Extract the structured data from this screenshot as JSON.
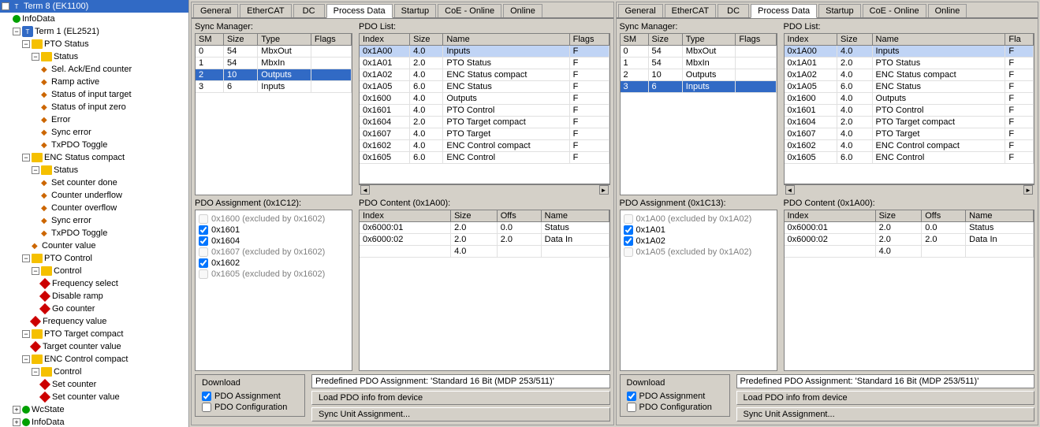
{
  "tree": {
    "items": [
      {
        "id": "term8",
        "label": "Term 8 (EK1100)",
        "level": 0,
        "type": "blue",
        "expanded": true
      },
      {
        "id": "infodata0",
        "label": "InfoData",
        "level": 1,
        "type": "folder"
      },
      {
        "id": "term1",
        "label": "Term 1 (EL2521)",
        "level": 1,
        "type": "blue",
        "expanded": true
      },
      {
        "id": "pto-status",
        "label": "PTO Status",
        "level": 2,
        "type": "folder",
        "expanded": true
      },
      {
        "id": "status1",
        "label": "Status",
        "level": 3,
        "type": "folder",
        "expanded": true
      },
      {
        "id": "sel-ack",
        "label": "Sel. Ack/End counter",
        "level": 4,
        "type": "arrow"
      },
      {
        "id": "ramp-active",
        "label": "Ramp active",
        "level": 4,
        "type": "arrow"
      },
      {
        "id": "status-input-target",
        "label": "Status of input target",
        "level": 4,
        "type": "arrow"
      },
      {
        "id": "status-input-zero",
        "label": "Status of input zero",
        "level": 4,
        "type": "arrow"
      },
      {
        "id": "error",
        "label": "Error",
        "level": 4,
        "type": "arrow"
      },
      {
        "id": "sync-error1",
        "label": "Sync error",
        "level": 4,
        "type": "arrow"
      },
      {
        "id": "txpdo-toggle1",
        "label": "TxPDO Toggle",
        "level": 4,
        "type": "arrow"
      },
      {
        "id": "enc-status",
        "label": "ENC Status compact",
        "level": 2,
        "type": "folder",
        "expanded": true
      },
      {
        "id": "status2",
        "label": "Status",
        "level": 3,
        "type": "folder",
        "expanded": true
      },
      {
        "id": "set-counter-done",
        "label": "Set counter done",
        "level": 4,
        "type": "arrow"
      },
      {
        "id": "counter-underflow",
        "label": "Counter underflow",
        "level": 4,
        "type": "arrow"
      },
      {
        "id": "counter-overflow",
        "label": "Counter overflow",
        "level": 4,
        "type": "arrow"
      },
      {
        "id": "sync-error2",
        "label": "Sync error",
        "level": 4,
        "type": "arrow"
      },
      {
        "id": "txpdo-toggle2",
        "label": "TxPDO Toggle",
        "level": 4,
        "type": "arrow"
      },
      {
        "id": "counter-value",
        "label": "Counter value",
        "level": 3,
        "type": "arrow"
      },
      {
        "id": "pto-control",
        "label": "PTO Control",
        "level": 2,
        "type": "folder",
        "expanded": true
      },
      {
        "id": "control1",
        "label": "Control",
        "level": 3,
        "type": "folder",
        "expanded": true
      },
      {
        "id": "freq-select",
        "label": "Frequency select",
        "level": 4,
        "type": "diamond"
      },
      {
        "id": "disable-ramp",
        "label": "Disable ramp",
        "level": 4,
        "type": "diamond"
      },
      {
        "id": "go-counter",
        "label": "Go counter",
        "level": 4,
        "type": "diamond"
      },
      {
        "id": "freq-value",
        "label": "Frequency value",
        "level": 3,
        "type": "diamond"
      },
      {
        "id": "pto-target",
        "label": "PTO Target compact",
        "level": 2,
        "type": "folder",
        "expanded": true
      },
      {
        "id": "target-counter-value",
        "label": "Target counter value",
        "level": 3,
        "type": "diamond"
      },
      {
        "id": "enc-control",
        "label": "ENC Control compact",
        "level": 2,
        "type": "folder",
        "expanded": true
      },
      {
        "id": "control2",
        "label": "Control",
        "level": 3,
        "type": "folder",
        "expanded": true
      },
      {
        "id": "set-counter",
        "label": "Set counter",
        "level": 4,
        "type": "diamond"
      },
      {
        "id": "set-counter-value",
        "label": "Set counter value",
        "level": 4,
        "type": "diamond"
      },
      {
        "id": "wcstate",
        "label": "WcState",
        "level": 1,
        "type": "green",
        "expanded": false
      },
      {
        "id": "infodata1",
        "label": "InfoData",
        "level": 1,
        "type": "green",
        "expanded": false
      }
    ]
  },
  "panel_left": {
    "tabs": [
      "General",
      "EtherCAT",
      "DC",
      "Process Data",
      "Startup",
      "CoE - Online",
      "Online"
    ],
    "active_tab": "Process Data",
    "sync_manager": {
      "label": "Sync Manager:",
      "columns": [
        "SM",
        "Size",
        "Type",
        "Flags"
      ],
      "rows": [
        {
          "sm": "0",
          "size": "54",
          "type": "MbxOut",
          "flags": ""
        },
        {
          "sm": "1",
          "size": "54",
          "type": "MbxIn",
          "flags": ""
        },
        {
          "sm": "2",
          "size": "10",
          "type": "Outputs",
          "flags": "",
          "selected": true
        },
        {
          "sm": "3",
          "size": "6",
          "type": "Inputs",
          "flags": ""
        }
      ]
    },
    "pdo_list": {
      "label": "PDO List:",
      "columns": [
        "Index",
        "Size",
        "Name",
        "Flags"
      ],
      "rows": [
        {
          "index": "0x1A00",
          "size": "4.0",
          "name": "Inputs",
          "flags": "F"
        },
        {
          "index": "0x1A01",
          "size": "2.0",
          "name": "PTO Status",
          "flags": "F"
        },
        {
          "index": "0x1A02",
          "size": "4.0",
          "name": "ENC Status compact",
          "flags": "F"
        },
        {
          "index": "0x1A05",
          "size": "6.0",
          "name": "ENC Status",
          "flags": "F"
        },
        {
          "index": "0x1600",
          "size": "4.0",
          "name": "Outputs",
          "flags": "F"
        },
        {
          "index": "0x1601",
          "size": "4.0",
          "name": "PTO Control",
          "flags": "F"
        },
        {
          "index": "0x1604",
          "size": "2.0",
          "name": "PTO Target compact",
          "flags": "F"
        },
        {
          "index": "0x1607",
          "size": "4.0",
          "name": "PTO Target",
          "flags": "F"
        },
        {
          "index": "0x1602",
          "size": "4.0",
          "name": "ENC Control compact",
          "flags": "F"
        },
        {
          "index": "0x1605",
          "size": "6.0",
          "name": "ENC Control",
          "flags": "F"
        }
      ]
    },
    "pdo_assignment": {
      "label": "PDO Assignment (0x1C12):",
      "items": [
        {
          "label": "0x1600 (excluded by 0x1602)",
          "checked": false,
          "disabled": true
        },
        {
          "label": "0x1601",
          "checked": true,
          "disabled": false
        },
        {
          "label": "0x1604",
          "checked": true,
          "disabled": false
        },
        {
          "label": "0x1607 (excluded by 0x1602)",
          "checked": false,
          "disabled": true
        },
        {
          "label": "0x1602",
          "checked": true,
          "disabled": false
        },
        {
          "label": "0x1605 (excluded by 0x1602)",
          "checked": false,
          "disabled": true
        }
      ]
    },
    "pdo_content": {
      "label": "PDO Content (0x1A00):",
      "columns": [
        "Index",
        "Size",
        "Offs",
        "Name"
      ],
      "rows": [
        {
          "index": "0x6000:01",
          "size": "2.0",
          "offs": "0.0",
          "name": "Status"
        },
        {
          "index": "0x6000:02",
          "size": "2.0",
          "offs": "2.0",
          "name": "Data In"
        },
        {
          "index": "",
          "size": "4.0",
          "offs": "",
          "name": ""
        }
      ]
    },
    "download": {
      "label": "Download",
      "pdo_assignment": {
        "label": "PDO Assignment",
        "checked": true
      },
      "pdo_configuration": {
        "label": "PDO Configuration",
        "checked": false
      }
    },
    "predefined": {
      "text": "Predefined PDO Assignment: 'Standard 16 Bit (MDP 253/511)'",
      "buttons": [
        "Load PDO info from device",
        "Sync Unit Assignment..."
      ]
    }
  },
  "panel_right": {
    "tabs": [
      "General",
      "EtherCAT",
      "DC",
      "Process Data",
      "Startup",
      "CoE - Online",
      "Online"
    ],
    "active_tab": "Process Data",
    "sync_manager": {
      "label": "Sync Manager:",
      "columns": [
        "SM",
        "Size",
        "Type",
        "Flags"
      ],
      "rows": [
        {
          "sm": "0",
          "size": "54",
          "type": "MbxOut",
          "flags": ""
        },
        {
          "sm": "1",
          "size": "54",
          "type": "MbxIn",
          "flags": ""
        },
        {
          "sm": "2",
          "size": "10",
          "type": "Outputs",
          "flags": ""
        },
        {
          "sm": "3",
          "size": "6",
          "type": "Inputs",
          "flags": "",
          "selected": true
        }
      ]
    },
    "pdo_list": {
      "label": "PDO List:",
      "columns": [
        "Index",
        "Size",
        "Name",
        "Fla"
      ],
      "rows": [
        {
          "index": "0x1A00",
          "size": "4.0",
          "name": "Inputs",
          "flags": "F"
        },
        {
          "index": "0x1A01",
          "size": "2.0",
          "name": "PTO Status",
          "flags": "F"
        },
        {
          "index": "0x1A02",
          "size": "4.0",
          "name": "ENC Status compact",
          "flags": "F"
        },
        {
          "index": "0x1A05",
          "size": "6.0",
          "name": "ENC Status",
          "flags": "F"
        },
        {
          "index": "0x1600",
          "size": "4.0",
          "name": "Outputs",
          "flags": "F"
        },
        {
          "index": "0x1601",
          "size": "4.0",
          "name": "PTO Control",
          "flags": "F"
        },
        {
          "index": "0x1604",
          "size": "2.0",
          "name": "PTO Target compact",
          "flags": "F"
        },
        {
          "index": "0x1607",
          "size": "4.0",
          "name": "PTO Target",
          "flags": "F"
        },
        {
          "index": "0x1602",
          "size": "4.0",
          "name": "ENC Control compact",
          "flags": "F"
        },
        {
          "index": "0x1605",
          "size": "6.0",
          "name": "ENC Control",
          "flags": "F"
        }
      ]
    },
    "pdo_assignment": {
      "label": "PDO Assignment (0x1C13):",
      "items": [
        {
          "label": "0x1A00 (excluded by 0x1A02)",
          "checked": false,
          "disabled": true
        },
        {
          "label": "0x1A01",
          "checked": true,
          "disabled": false
        },
        {
          "label": "0x1A02",
          "checked": true,
          "disabled": false
        },
        {
          "label": "0x1A05 (excluded by 0x1A02)",
          "checked": false,
          "disabled": true
        }
      ]
    },
    "pdo_content": {
      "label": "PDO Content (0x1A00):",
      "columns": [
        "Index",
        "Size",
        "Offs",
        "Name"
      ],
      "rows": [
        {
          "index": "0x6000:01",
          "size": "2.0",
          "offs": "0.0",
          "name": "Status"
        },
        {
          "index": "0x6000:02",
          "size": "2.0",
          "offs": "2.0",
          "name": "Data In"
        },
        {
          "index": "",
          "size": "4.0",
          "offs": "",
          "name": ""
        }
      ]
    },
    "download": {
      "label": "Download",
      "pdo_assignment": {
        "label": "PDO Assignment",
        "checked": true
      },
      "pdo_configuration": {
        "label": "PDO Configuration",
        "checked": false
      }
    },
    "predefined": {
      "text": "Predefined PDO Assignment: 'Standard 16 Bit (MDP 253/511)'",
      "buttons": [
        "Load PDO info from device",
        "Sync Unit Assignment..."
      ]
    }
  }
}
